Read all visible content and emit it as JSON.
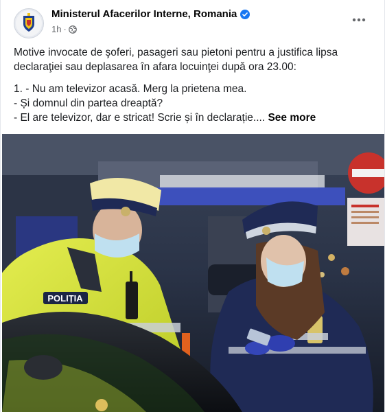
{
  "post": {
    "page_name": "Ministerul Afacerilor Interne, Romania",
    "verified_icon": "verified-badge-icon",
    "time": "1h",
    "separator": "·",
    "audience_icon": "globe-icon",
    "more_icon": "more-options-icon",
    "text_lines": [
      "Motive invocate de şoferi, pasageri sau pietoni pentru a justifica lipsa",
      "declaraţiei sau deplasarea în afara locuinţei după ora 23.00:"
    ],
    "dialogue_lines": [
      "1. - Nu am televizor acasă. Merg la prietena mea.",
      "- Și domnul din partea dreaptă?",
      "- El are televizor, dar e stricat! Scrie și în declarație...."
    ],
    "see_more_label": "See more"
  },
  "photo": {
    "vest_label": "POLIȚIA"
  },
  "colors": {
    "verified": "#1877f2",
    "secondary_text": "#65676b",
    "vest_yellow": "#d8e63a",
    "police_blue": "#1f2a55"
  }
}
